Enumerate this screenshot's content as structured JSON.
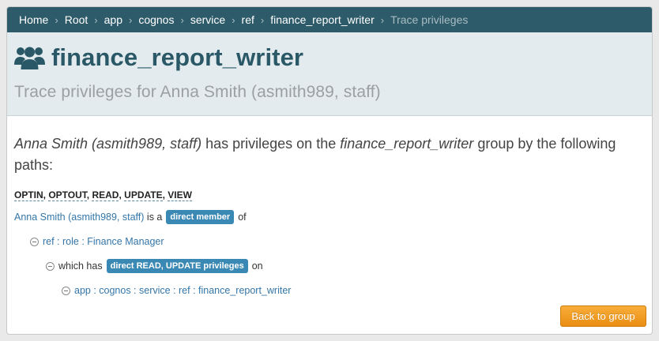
{
  "breadcrumb": {
    "items": [
      "Home",
      "Root",
      "app",
      "cognos",
      "service",
      "ref",
      "finance_report_writer"
    ],
    "current": "Trace privileges",
    "separator": "›"
  },
  "header": {
    "icon": "users-icon",
    "title": "finance_report_writer",
    "subtitle": "Trace privileges for Anna Smith (asmith989, staff)"
  },
  "intro": {
    "subject": "Anna Smith (asmith989, staff)",
    "text1": " has privileges on the ",
    "group": "finance_report_writer",
    "text2": " group by the following paths:"
  },
  "privileges": [
    "OPTIN",
    "OPTOUT",
    "READ",
    "UPDATE",
    "VIEW"
  ],
  "paths": {
    "member_link": "Anna Smith (asmith989, staff)",
    "member_is": "is a",
    "member_badge": "direct member",
    "member_of": "of",
    "role_link": "ref : role : Finance Manager",
    "which_has": "which has",
    "priv_badge": "direct READ, UPDATE privileges",
    "on": "on",
    "target_link": "app : cognos : service : ref : finance_report_writer"
  },
  "actions": {
    "back_label": "Back to group"
  },
  "colors": {
    "breadcrumb_bg": "#2e5b6a",
    "title": "#2a5866",
    "badge": "#3a88b4",
    "button": "#ea8d12",
    "link": "#3476a8"
  }
}
